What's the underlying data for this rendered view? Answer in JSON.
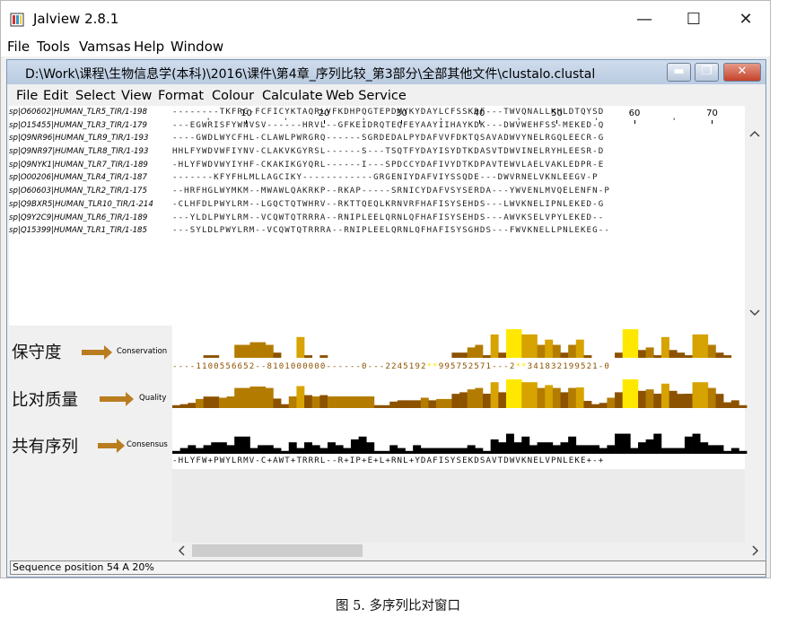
{
  "window": {
    "title": "Jalview 2.8.1",
    "min_label": "—",
    "max_label": "☐",
    "close_label": "✕"
  },
  "menubar": [
    "File",
    "Tools",
    "Vamsas",
    "Help",
    "Window"
  ],
  "inner_window": {
    "title": "D:\\Work\\课程\\生物信息学(本科)\\2016\\课件\\第4章_序列比较_第3部分\\全部其他文件\\clustalo.clustal",
    "menu": [
      "File",
      "Edit",
      "Select",
      "View",
      "Format",
      "Colour",
      "Calculate",
      "Web Service"
    ]
  },
  "ruler_ticks": [
    "10",
    "20",
    "30",
    "40",
    "50",
    "60",
    "70"
  ],
  "sequences": [
    {
      "name": "sp|O60602|HUMAN_TLR5_TIR/1-198",
      "residues": "--------TKFRG-FCFICYKTAQRLVFKDHPQGTEPDMYKYDAYLCFSSKDF---TWVQNALLKHLDTQYSD"
    },
    {
      "name": "sp|O15455|HUMAN_TLR3_TIR/1-179",
      "residues": "---EGWRISFYWNVSV------HRVL--GFKEIDRQTEQFEYAAYIIHAYKDK---DWVWEHFSS-MEKED-Q"
    },
    {
      "name": "sp|Q9NR96|HUMAN_TLR9_TIR/1-193",
      "residues": "----GWDLWYCFHL-CLAWLPWRGRQ------SGRDEDALPYDAFVVFDKTQSAVADWVYNELRGQLEECR-G"
    },
    {
      "name": "sp|Q9NR97|HUMAN_TLR8_TIR/1-193",
      "residues": "HHLFYWDVWFIYNV-CLAKVKGYRSL------S---TSQTFYDAYISYDTKDASVTDWVINELRYHLEESR-D"
    },
    {
      "name": "sp|Q9NYK1|HUMAN_TLR7_TIR/1-189",
      "residues": "-HLYFWDVWYIYHF-CKAKIKGYQRL------I---SPDCCYDAFIVYDTKDPAVTEWVLAELVAKLEDPR-E"
    },
    {
      "name": "sp|O00206|HUMAN_TLR4_TIR/1-187",
      "residues": "-------KFYFHLMLLAGCIKY------------GRGENIYDAFVIYSSQDE---DWVRNELVKNLEEGV-P"
    },
    {
      "name": "sp|O60603|HUMAN_TLR2_TIR/1-175",
      "residues": "--HRFHGLWYMKM--MWAWLQAKRKP--RKAP-----SRNICYDAFVSYSERDA---YWVENLMVQELENFN-P"
    },
    {
      "name": "sp|Q9BXR5|HUMAN_TLR10_TIR/1-214",
      "residues": "-CLHFDLPWYLRM--LGQCTQTWHRV--RKTTQEQLKRNVRFHAFISYSEHDS---LWVKNELIPNLEKED-G"
    },
    {
      "name": "sp|Q9Y2C9|HUMAN_TLR6_TIR/1-189",
      "residues": "---YLDLPWYLRM--VCQWTQTRRRA--RNIPLEELQRNLQFHAFISYSEHDS---AWVKSELVPYLEKED--"
    },
    {
      "name": "sp|Q15399|HUMAN_TLR1_TIR/1-185",
      "residues": "---SYLDLPWYLRM--VCQWTQTRRRA--RNIPLEELQRNLQFHAFISYSGHDS---FWVKNELLPNLEKEG--"
    }
  ],
  "annotations": {
    "conservation": {
      "cn_label": "保守度",
      "label": "Conservation",
      "values_text": "----1100556652--8101000000------0---2245192**995752571---2**341832199521-0"
    },
    "quality": {
      "cn_label": "比对质量",
      "label": "Quality"
    },
    "consensus": {
      "cn_label": "共有序列",
      "label": "Consensus",
      "sequence": "-HLYFW+PWYLRMV-C+AWT+TRRRL--R+IP+E+L+RNL+YDAFISYSEKDSAVTDWVKNELVPNLEKE+-+"
    }
  },
  "colors": {
    "conservation_high": "#ffe800",
    "conservation_mid": "#d7a300",
    "conservation_low": "#8c5200",
    "consensus": "#000000",
    "arrow": "#b97d1f"
  },
  "scroll": {
    "left_arrow": "<",
    "right_arrow": ">",
    "up_arrow": "^",
    "down_arrow": "v"
  },
  "status": "Sequence position 54  A 20%",
  "caption": "图 5. 多序列比对窗口"
}
